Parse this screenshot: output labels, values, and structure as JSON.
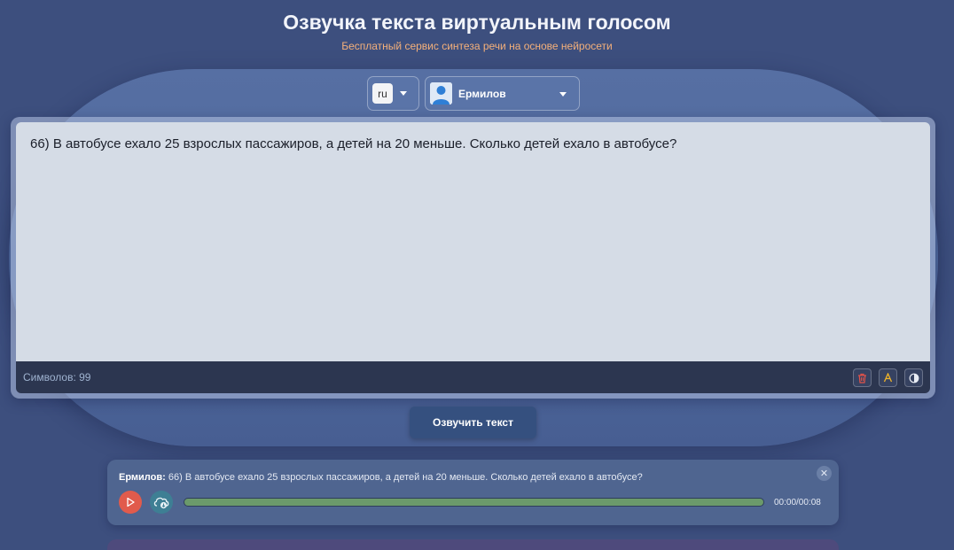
{
  "header": {
    "title": "Озвучка текста виртуальным голосом",
    "subtitle": "Бесплатный сервис синтеза речи на основе нейросети"
  },
  "controls": {
    "language": "ru",
    "voice": "Ермилов"
  },
  "editor": {
    "text": "66) В автобусе ехало 25 взрослых пассажиров, а детей на 20 меньше. Сколько детей ехало в автобусе?",
    "char_count_label": "Символов: 99"
  },
  "speak_button": "Озвучить текст",
  "audio_card": {
    "speaker": "Ермилов:",
    "text": "66) В автобусе ехало 25 взрослых пассажиров, а детей на 20 меньше. Сколько детей ехало в автобусе?",
    "time": "00:00/00:08",
    "progress": 1.0
  },
  "colors": {
    "background": "#3d4f7e",
    "subtitle": "#f4b07a",
    "play_button": "#e15b4c",
    "download_button": "#3e7f94",
    "progress_fill": "#6b9a6b"
  },
  "icons": [
    "user-avatar-icon",
    "trash-icon",
    "font-icon",
    "contrast-icon",
    "close-icon",
    "play-icon",
    "cloud-download-icon"
  ]
}
